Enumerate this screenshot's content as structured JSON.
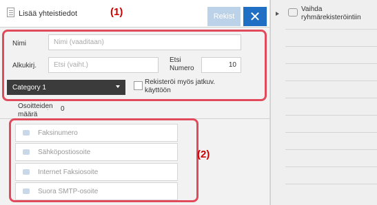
{
  "header": {
    "title": "Lisää yhteistiedot",
    "register_label": "Rekist",
    "close_label": "✕"
  },
  "callouts": {
    "one": "(1)",
    "two": "(2)"
  },
  "form": {
    "name_label": "Nimi",
    "name_placeholder": "Nimi (vaaditaan)",
    "initial_label": "Alkukirj.",
    "initial_placeholder": "Etsi (vaiht.)",
    "search_number_label": "Etsi Numero",
    "search_number_value": "10",
    "category_value": "Category 1",
    "register_continuous_label": "Rekisteröi myös jatkuv. käyttöön"
  },
  "address_count": {
    "label": "Osoitteiden määrä",
    "value": "0"
  },
  "address_rows": [
    {
      "label": "Faksinumero",
      "icon": "phone-icon"
    },
    {
      "label": "Sähköpostiosoite",
      "icon": "email-icon"
    },
    {
      "label": "Internet Faksiosoite",
      "icon": "internet-fax-icon"
    },
    {
      "label": "Suora SMTP-osoite",
      "icon": "smtp-icon"
    }
  ],
  "side": {
    "switch_group_label": "Vaihda ryhmärekisteröintiin"
  },
  "colors": {
    "accent": "#1f6fc4",
    "callout": "#cc0000",
    "highlight_border": "#e04a5a"
  }
}
